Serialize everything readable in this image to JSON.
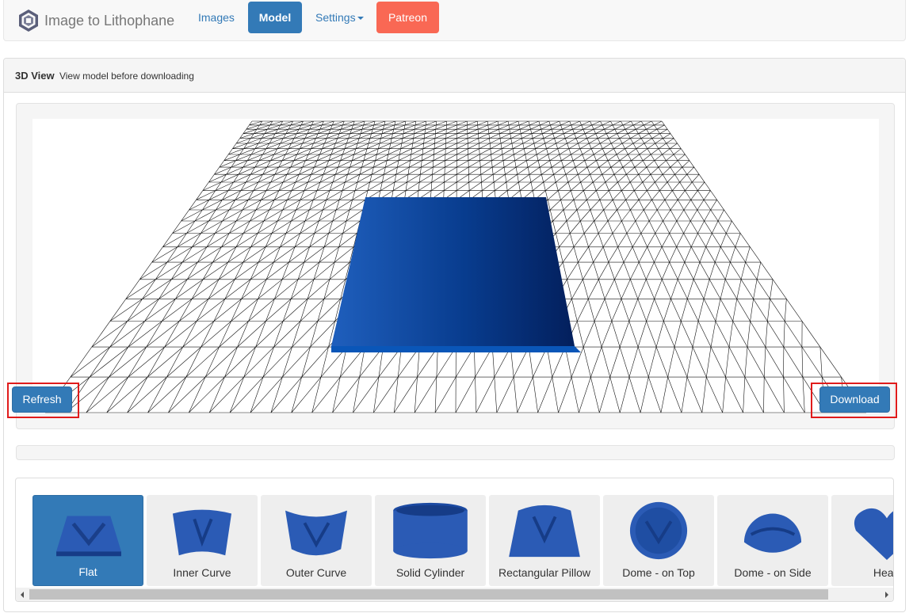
{
  "brand": {
    "title": "Image to Lithophane",
    "logo_icon": "lithophane-hexagon-logo-icon"
  },
  "nav": {
    "images": "Images",
    "model": "Model",
    "settings": "Settings",
    "patreon": "Patreon"
  },
  "panel": {
    "title": "3D View",
    "subtitle": "View model before downloading"
  },
  "buttons": {
    "refresh": "Refresh",
    "download": "Download"
  },
  "shapes": [
    {
      "label": "Flat",
      "active": true
    },
    {
      "label": "Inner Curve",
      "active": false
    },
    {
      "label": "Outer Curve",
      "active": false
    },
    {
      "label": "Solid Cylinder",
      "active": false
    },
    {
      "label": "Rectangular Pillow",
      "active": false
    },
    {
      "label": "Dome - on Top",
      "active": false
    },
    {
      "label": "Dome - on Side",
      "active": false
    },
    {
      "label": "Heart",
      "active": false
    }
  ],
  "colors": {
    "primary": "#337ab7",
    "patreon": "#f96854",
    "model_blue": "#0a3c8c",
    "highlight": "#e01b1b"
  }
}
